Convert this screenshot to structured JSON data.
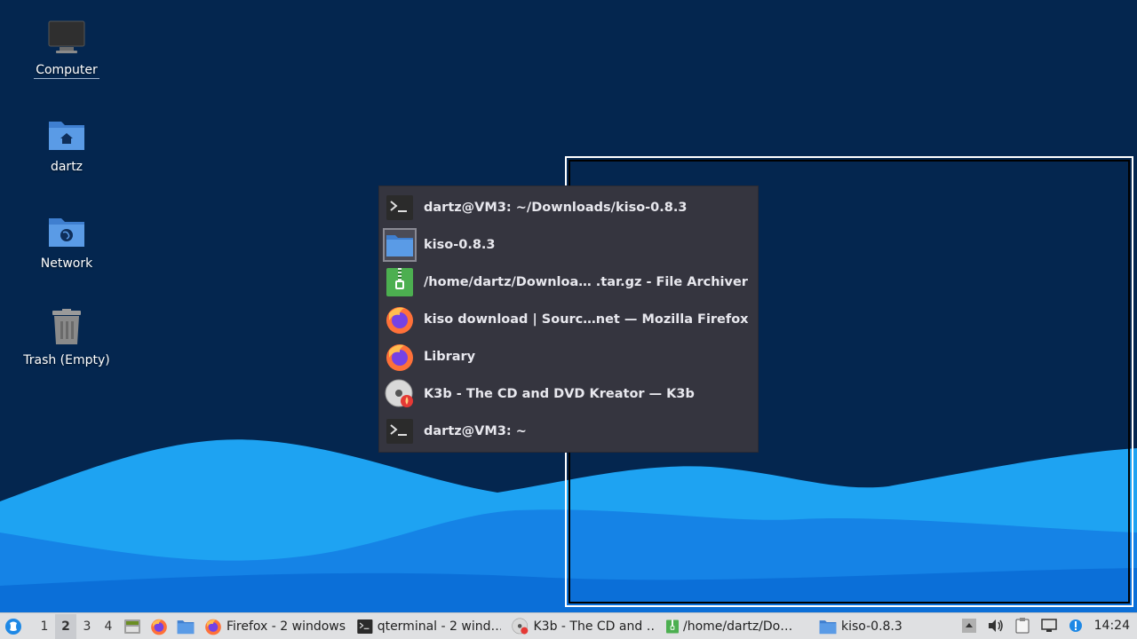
{
  "desktop": {
    "icons": [
      {
        "label": "Computer"
      },
      {
        "label": "dartz"
      },
      {
        "label": "Network"
      },
      {
        "label": "Trash (Empty)"
      }
    ]
  },
  "switcher": {
    "items": [
      {
        "label": "dartz@VM3: ~/Downloads/kiso-0.8.3",
        "icon": "terminal-icon"
      },
      {
        "label": "kiso-0.8.3",
        "icon": "folder-icon"
      },
      {
        "label": "/home/dartz/Downloa… .tar.gz - File Archiver",
        "icon": "archive-icon"
      },
      {
        "label": "kiso download | Sourc…net — Mozilla Firefox",
        "icon": "firefox-icon"
      },
      {
        "label": "Library",
        "icon": "firefox-icon"
      },
      {
        "label": "K3b - The CD and DVD Kreator — K3b",
        "icon": "k3b-icon"
      },
      {
        "label": "dartz@VM3: ~",
        "icon": "terminal-icon"
      }
    ]
  },
  "taskbar": {
    "desktops": [
      "1",
      "2",
      "3",
      "4"
    ],
    "active_desktop": "2",
    "tasks": [
      {
        "label": "Firefox - 2 windows",
        "icon": "firefox-icon"
      },
      {
        "label": "qterminal - 2 wind…",
        "icon": "terminal-icon"
      },
      {
        "label": "K3b - The CD and …",
        "icon": "k3b-icon"
      },
      {
        "label": "/home/dartz/Do…",
        "icon": "archive-icon"
      },
      {
        "label": "kiso-0.8.3",
        "icon": "folder-icon"
      }
    ],
    "clock": "14:24"
  },
  "colors": {
    "desktop_bg": "#04264f",
    "wave_light": "#1a9bf0",
    "wave_dark": "#0a6fd6",
    "switcher_bg": "#35353f",
    "taskbar_bg": "#dfe0e2"
  }
}
